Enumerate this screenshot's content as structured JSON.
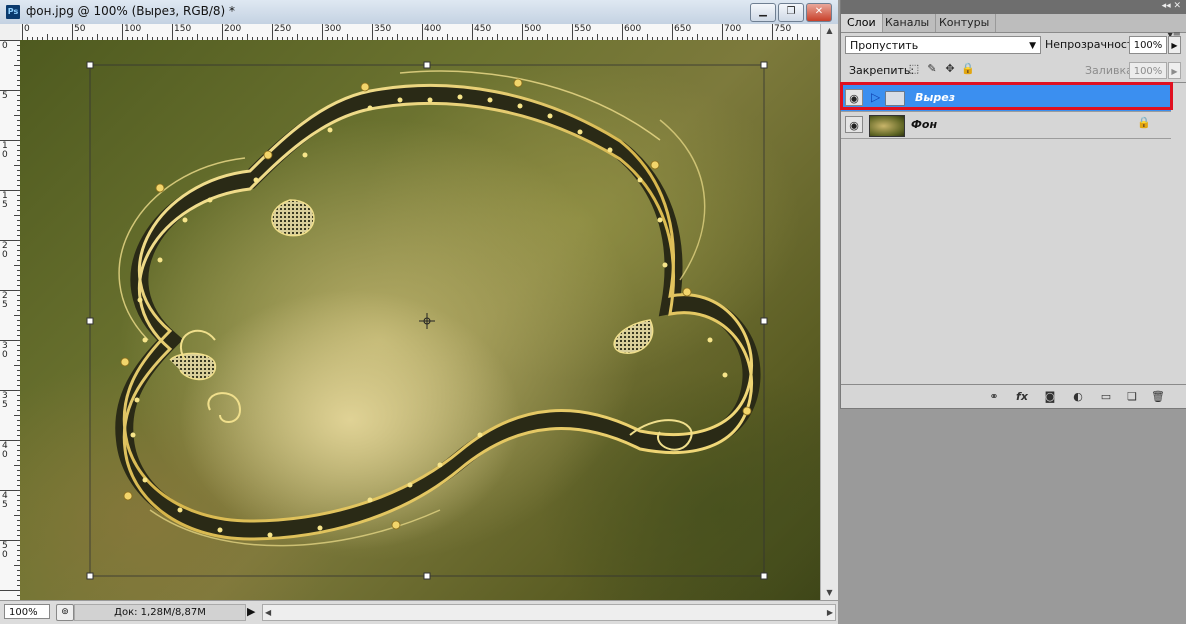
{
  "document": {
    "title": "фон.jpg @ 100% (Вырез, RGB/8) *",
    "app_icon": "Ps",
    "window_buttons": [
      "minimize-icon",
      "restore-icon",
      "close-icon"
    ],
    "ruler_top_labels": [
      "0",
      "50",
      "100",
      "150",
      "200",
      "250",
      "300",
      "350",
      "400",
      "450",
      "500",
      "550",
      "600",
      "650",
      "700",
      "750"
    ],
    "ruler_left_labels": [
      "0",
      "5",
      "1 0",
      "1 5",
      "2 0",
      "2 5",
      "3 0",
      "3 5",
      "4 0",
      "4 5",
      "5 0"
    ],
    "status": {
      "zoom": "100%",
      "doc_info": "Док: 1,28M/8,87M"
    }
  },
  "layers_panel": {
    "tabs": [
      "Слои",
      "Каналы",
      "Контуры"
    ],
    "blend_mode": "Пропустить",
    "opacity_label": "Непрозрачность:",
    "opacity_value": "100%",
    "lock_label": "Закрепить:",
    "fill_label": "Заливка:",
    "fill_value": "100%",
    "layers": [
      {
        "name": "Вырез",
        "type": "group",
        "visible": true,
        "selected": true
      },
      {
        "name": "Фон",
        "type": "image",
        "visible": true,
        "selected": false,
        "locked": true
      }
    ],
    "highlight_color": "#e01020"
  },
  "colors": {
    "selection": "#3b8ff0",
    "frame_gold": "#e8cf6a",
    "frame_dark": "#2a2a16"
  }
}
